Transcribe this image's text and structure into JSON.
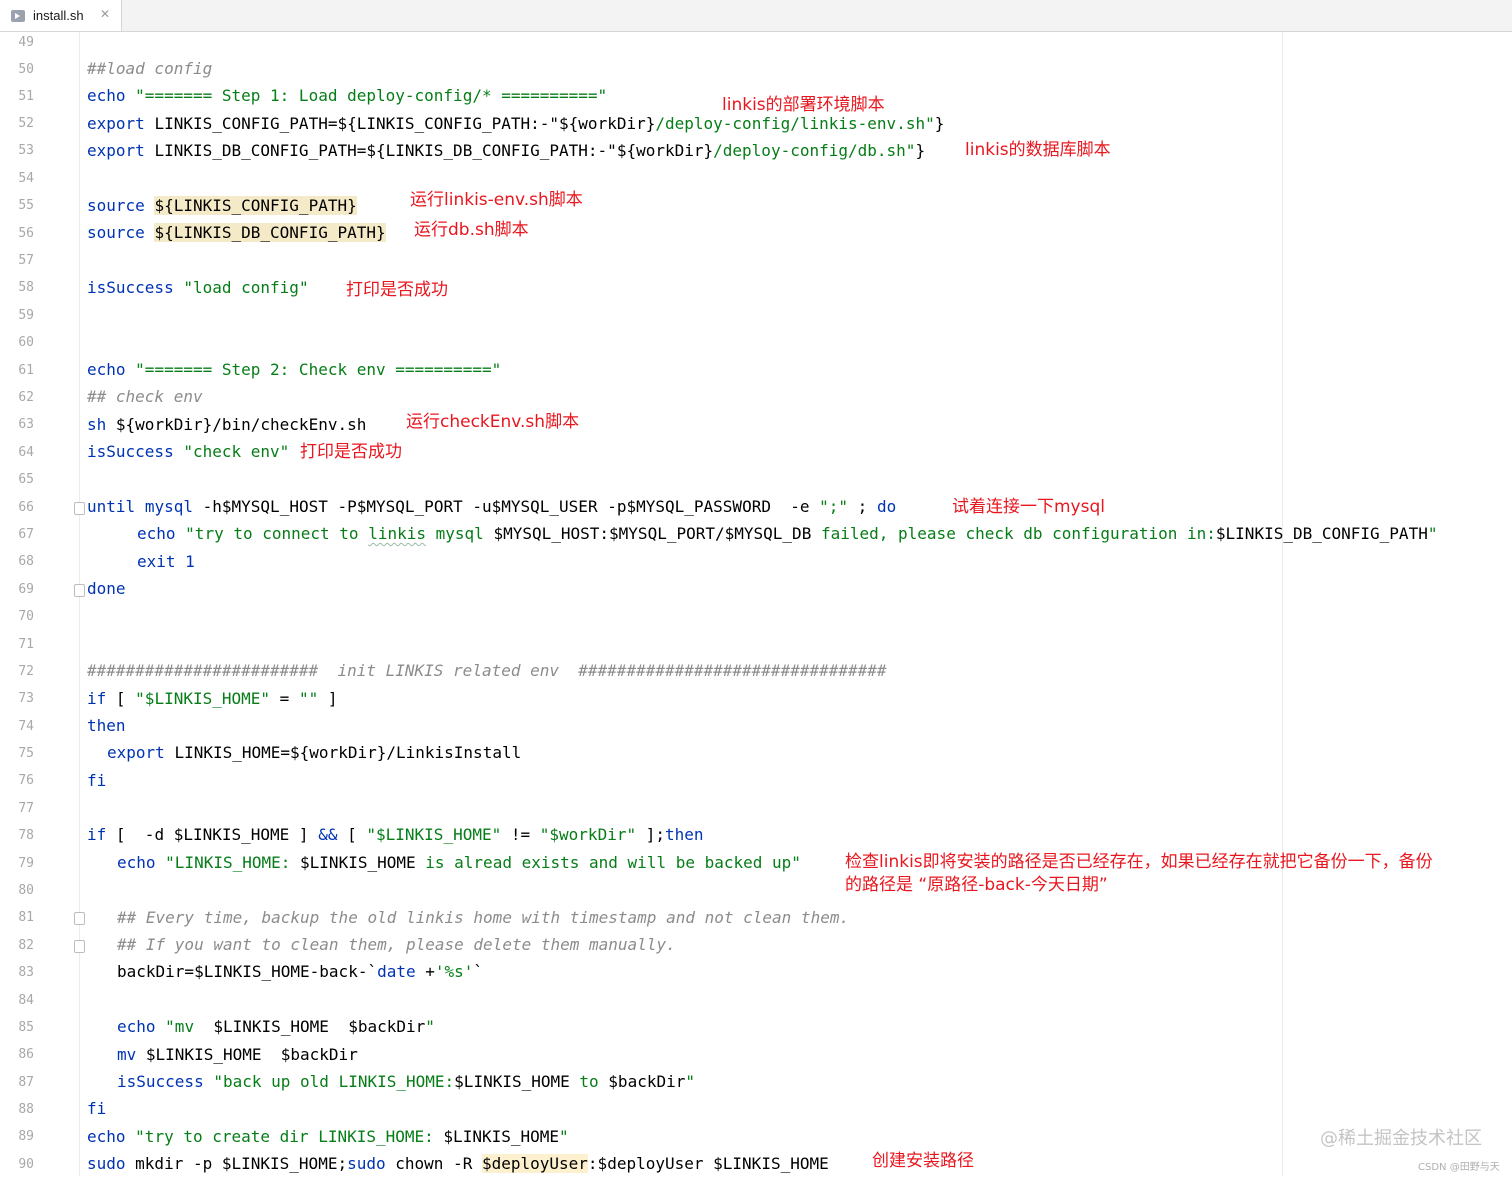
{
  "tab": {
    "label": "install.sh",
    "close": "✕",
    "icon": "shell-file-icon"
  },
  "lines": {
    "n49": "49",
    "n50": "50",
    "n51": "51",
    "n52": "52",
    "n53": "53",
    "n54": "54",
    "n55": "55",
    "n56": "56",
    "n57": "57",
    "n58": "58",
    "n59": "59",
    "n60": "60",
    "n61": "61",
    "n62": "62",
    "n63": "63",
    "n64": "64",
    "n65": "65",
    "n66": "66",
    "n67": "67",
    "n68": "68",
    "n69": "69",
    "n70": "70",
    "n71": "71",
    "n72": "72",
    "n73": "73",
    "n74": "74",
    "n75": "75",
    "n76": "76",
    "n77": "77",
    "n78": "78",
    "n79": "79",
    "n80": "80",
    "n81": "81",
    "n82": "82",
    "n83": "83",
    "n84": "84",
    "n85": "85",
    "n86": "86",
    "n87": "87",
    "n88": "88",
    "n89": "89",
    "n90": "90"
  },
  "code": {
    "c50": "##load config",
    "c51_kw": "echo",
    "c51_str": "\"======= Step 1: Load deploy-config/* ==========\"",
    "c52_kw": "export",
    "c52_a": "LINKIS_CONFIG_PATH=",
    "c52_b": "${LINKIS_CONFIG_PATH:-\"",
    "c52_c": "${workDir}",
    "c52_d": "/deploy-config/linkis-env.sh\"",
    "c52_e": "}",
    "c53_kw": "export",
    "c53_a": "LINKIS_DB_CONFIG_PATH=",
    "c53_b": "${LINKIS_DB_CONFIG_PATH:-\"",
    "c53_c": "${workDir}",
    "c53_d": "/deploy-config/db.sh\"",
    "c53_e": "}",
    "c55_kw": "source",
    "c55_a": "${LINKIS_CONFIG_PATH}",
    "c56_kw": "source",
    "c56_a": "${LINKIS_DB_CONFIG_PATH}",
    "c58_kw": "isSuccess",
    "c58_str": "\"load config\"",
    "c61_kw": "echo",
    "c61_str": "\"======= Step 2: Check env ==========\"",
    "c62": "## check env",
    "c63_kw": "sh",
    "c63_a": "${workDir}/bin/checkEnv.sh",
    "c64_kw": "isSuccess",
    "c64_str": "\"check env\"",
    "c66_kw": "until",
    "c66_kw2": "mysql",
    "c66_a": "-h$MYSQL_HOST -P$MYSQL_PORT -u$MYSQL_USER -p$MYSQL_PASSWORD  -e ",
    "c66_str": "\";\"",
    "c66_b": " ; ",
    "c66_kw3": "do",
    "c67_kw": "echo",
    "c67_s1": "\"try to connect to ",
    "c67_s2": "linkis",
    "c67_s3": " mysql ",
    "c67_v": "$MYSQL_HOST:$MYSQL_PORT/$MYSQL_DB",
    "c67_s4": " failed, please check db configuration in:",
    "c67_v2": "$LINKIS_DB_CONFIG_PATH",
    "c67_s5": "\"",
    "c68_kw": "exit",
    "c68_n": "1",
    "c69_kw": "done",
    "c72": "########################  init LINKIS related env  ################################",
    "c73_kw": "if",
    "c73_a": "[ ",
    "c73_str": "\"$LINKIS_HOME\"",
    "c73_b": " = ",
    "c73_str2": "\"\"",
    "c73_c": " ]",
    "c74_kw": "then",
    "c75_kw": "export",
    "c75_a": "LINKIS_HOME=${workDir}/LinkisInstall",
    "c76_kw": "fi",
    "c78_kw": "if",
    "c78_a": "[  -d $LINKIS_HOME ] ",
    "c78_op": "&&",
    "c78_b": " [ ",
    "c78_str": "\"$LINKIS_HOME\"",
    "c78_c": " != ",
    "c78_str2": "\"$workDir\"",
    "c78_d": " ];",
    "c78_kw2": "then",
    "c79_kw": "echo",
    "c79_s1": "\"LINKIS_HOME: ",
    "c79_v": "$LINKIS_HOME",
    "c79_s2": " is alread exists and will be backed up\"",
    "c81": "## Every time, backup the old linkis home with timestamp and not clean them.",
    "c82": "## If you want to clean them, please delete them manually.",
    "c83_a": "backDir=$LINKIS_HOME-back-`",
    "c83_kw": "date",
    "c83_b": " +",
    "c83_str": "'%s'",
    "c83_c": "`",
    "c85_kw": "echo",
    "c85_s1": "\"mv  ",
    "c85_v": "$LINKIS_HOME  $backDir",
    "c85_s2": "\"",
    "c86_kw": "mv",
    "c86_a": " $LINKIS_HOME  $backDir",
    "c87_kw": "isSuccess",
    "c87_s1": "\"back up old LINKIS_HOME:",
    "c87_v": "$LINKIS_HOME",
    "c87_s2": " to ",
    "c87_v2": "$backDir",
    "c87_s3": "\"",
    "c88_kw": "fi",
    "c89_kw": "echo",
    "c89_s1": "\"try to create dir LINKIS_HOME: ",
    "c89_v": "$LINKIS_HOME",
    "c89_s2": "\"",
    "c90_kw": "sudo",
    "c90_a": " mkdir -p $LINKIS_HOME;",
    "c90_kw2": "sudo",
    "c90_b": " chown -R ",
    "c90_hl": "$deployUser",
    "c90_c": ":$deployUser $LINKIS_HOME"
  },
  "annotations": {
    "a52": "linkis的部署环境脚本",
    "a53": "linkis的数据库脚本",
    "a55": "运行linkis-env.sh脚本",
    "a56": "运行db.sh脚本",
    "a58": "打印是否成功",
    "a63": "运行checkEnv.sh脚本",
    "a64": "打印是否成功",
    "a66": "试着连接一下mysql",
    "a79": "检查linkis即将安装的路径是否已经存在，如果已经存在就把它备份一下，备份\n的路径是 “原路径-back-今天日期”",
    "a90": "创建安装路径"
  },
  "watermark": "@稀土掘金技术社区",
  "credit": "CSDN @田野与天"
}
